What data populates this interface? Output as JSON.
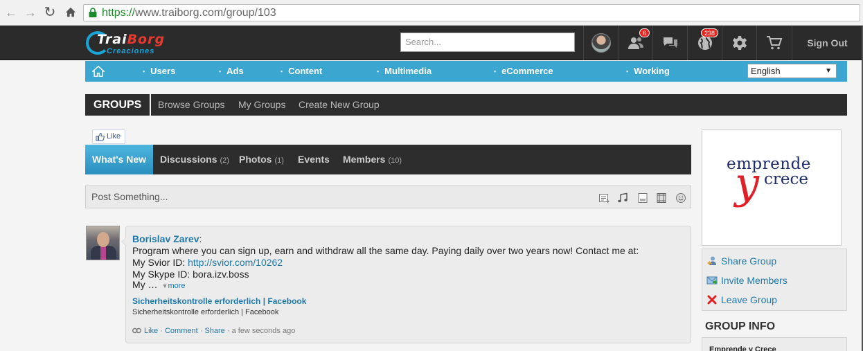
{
  "browser": {
    "url_scheme": "https://",
    "url_rest": "www.traiborg.com/group/103",
    "back_icon": "arrow-left",
    "forward_icon": "arrow-right",
    "reload_icon": "reload",
    "home_icon": "home"
  },
  "header": {
    "logo_main_1": "Trai",
    "logo_main_2": "Borg",
    "logo_sub": "Creaciones",
    "search_placeholder": "Search...",
    "friends_badge": "6",
    "notifications_badge": "238",
    "sign_out": "Sign Out"
  },
  "mainnav": {
    "items": [
      "Users",
      "Ads",
      "Content",
      "Multimedia",
      "eCommerce",
      "Working"
    ],
    "language": "English"
  },
  "groupsbar": {
    "title": "GROUPS",
    "links": [
      "Browse Groups",
      "My Groups",
      "Create New Group"
    ]
  },
  "like_button": "Like",
  "tabs": {
    "whats_new": "What's New",
    "discussions": "Discussions",
    "discussions_count": "(2)",
    "photos": "Photos",
    "photos_count": "(1)",
    "events": "Events",
    "members": "Members",
    "members_count": "(10)"
  },
  "postbox": {
    "placeholder": "Post Something..."
  },
  "activity": {
    "author": "Borislav Zarev",
    "line1": "Program where you can sign up, earn and withdraw all the same day. Paying daily over two years now! Contact me at:",
    "svior_label": "My Svior ID:",
    "svior_link": "http://svior.com/10262",
    "skype_line": "My Skype ID: bora.izv.boss",
    "truncated": "My …",
    "more": "more",
    "link_title": "Sicherheitskontrolle erforderlich | Facebook",
    "link_desc": "Sicherheitskontrolle erforderlich | Facebook",
    "like": "Like",
    "comment": "Comment",
    "share": "Share",
    "time": "a few seconds ago"
  },
  "sidebar": {
    "logo_line1": "emprende",
    "logo_y": "y",
    "logo_line2": "crece",
    "share_group": "Share Group",
    "invite_members": "Invite Members",
    "leave_group": "Leave Group",
    "group_info_title": "GROUP INFO",
    "group_name": "Emprende y Crece"
  },
  "colors": {
    "nav_blue": "#3ba7d1",
    "dark_bar": "#2d2d2d",
    "link_blue": "#1f78a8",
    "badge_red": "#e8231d"
  }
}
